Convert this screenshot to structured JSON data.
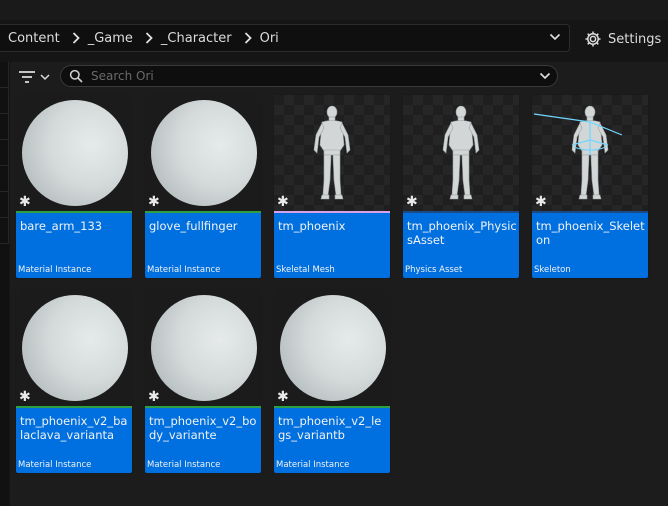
{
  "breadcrumb": {
    "items": [
      "Content",
      "_Game",
      "_Character",
      "Ori"
    ]
  },
  "settings": {
    "label": "Settings"
  },
  "search": {
    "placeholder": "Search Ori",
    "value": ""
  },
  "colors": {
    "tile_bg": "#0070e0",
    "material_instance": "#2ea043",
    "skeletal_mesh": "#d8a0e8",
    "physics_asset": "#1b4a85",
    "skeleton": "#1b4a85"
  },
  "assets": [
    {
      "name": "bare_arm_133",
      "type": "Material Instance",
      "thumb": "sphere",
      "line_color": "#2ea043"
    },
    {
      "name": "glove_fullfinger",
      "type": "Material Instance",
      "thumb": "sphere",
      "line_color": "#2ea043"
    },
    {
      "name": "tm_phoenix",
      "type": "Skeletal Mesh",
      "thumb": "character",
      "line_color": "#d8a0e8"
    },
    {
      "name": "tm_phoenix_PhysicsAsset",
      "type": "Physics Asset",
      "thumb": "character",
      "line_color": "#1b4a85"
    },
    {
      "name": "tm_phoenix_Skeleton",
      "type": "Skeleton",
      "thumb": "character-skeleton",
      "line_color": "#1b4a85"
    },
    {
      "name": "tm_phoenix_v2_balaclava_varianta",
      "type": "Material Instance",
      "thumb": "sphere",
      "line_color": "#2ea043"
    },
    {
      "name": "tm_phoenix_v2_body_variante",
      "type": "Material Instance",
      "thumb": "sphere",
      "line_color": "#2ea043"
    },
    {
      "name": "tm_phoenix_v2_legs_variantb",
      "type": "Material Instance",
      "thumb": "sphere",
      "line_color": "#2ea043"
    }
  ]
}
